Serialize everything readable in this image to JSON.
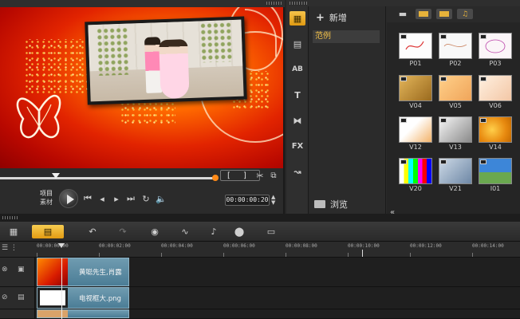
{
  "preview": {
    "mode_labels": [
      "项目",
      "素材"
    ],
    "timecode": "00:00:00:20",
    "trim_marks": [
      "[",
      "]"
    ]
  },
  "library": {
    "add_label": "新增",
    "folder_selected": "范例",
    "browse_label": "浏览",
    "thumbs": [
      {
        "label": "P01"
      },
      {
        "label": "P02"
      },
      {
        "label": "P03"
      },
      {
        "label": "V04"
      },
      {
        "label": "V05"
      },
      {
        "label": "V06"
      },
      {
        "label": "V12"
      },
      {
        "label": "V13"
      },
      {
        "label": "V14"
      },
      {
        "label": "V20"
      },
      {
        "label": "V21"
      },
      {
        "label": "I01"
      }
    ]
  },
  "side_tools": [
    "media",
    "instant-project",
    "title",
    "text",
    "transition",
    "fx",
    "path"
  ],
  "timeline": {
    "ruler_labels": [
      "00:00:00:00",
      "00:00:02:00",
      "00:00:04:00",
      "00:00:06:00",
      "00:00:08:00",
      "00:00:10:00",
      "00:00:12:00",
      "00:00:14:00"
    ],
    "tracks": [
      {
        "clip_label": "黄聪先生,肖露"
      },
      {
        "clip_label": "电视框大.png"
      }
    ]
  },
  "colors": {
    "accent": "#f2c14a",
    "scrub_end": "#ff8a18",
    "clip": "#5d8ca4"
  }
}
